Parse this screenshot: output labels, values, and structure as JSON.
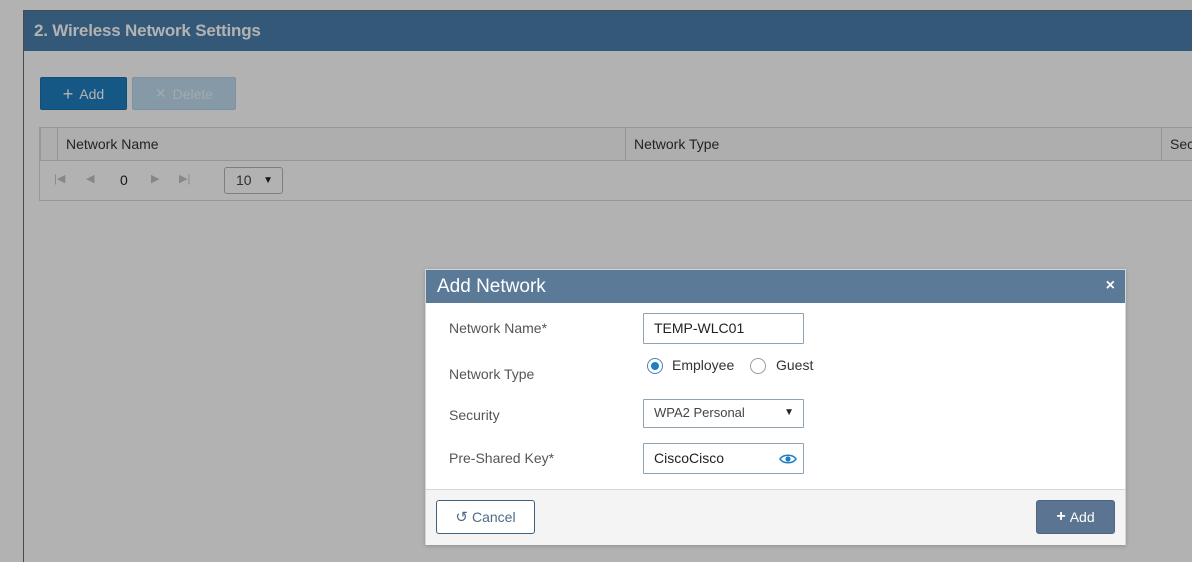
{
  "section": {
    "title": "2. Wireless Network Settings"
  },
  "toolbar": {
    "add_label": "Add",
    "delete_label": "Delete"
  },
  "grid": {
    "columns": [
      "Network Name",
      "Network Type",
      "Sec"
    ],
    "page_number": "0",
    "page_size": "10"
  },
  "modal": {
    "title": "Add Network",
    "close_glyph": "×",
    "fields": {
      "network_name": {
        "label": "Network Name*",
        "value": "TEMP-WLC01"
      },
      "network_type": {
        "label": "Network Type",
        "options": [
          "Employee",
          "Guest"
        ],
        "selected": "Employee"
      },
      "security": {
        "label": "Security",
        "value": "WPA2 Personal"
      },
      "psk": {
        "label": "Pre-Shared Key*",
        "value": "CiscoCisco"
      }
    },
    "cancel_label": "Cancel",
    "add_label": "Add"
  },
  "colors": {
    "section_header": "#4a7fad",
    "primary_button": "#1f7fc1",
    "modal_header": "#5a7a98",
    "modal_add_button": "#5a7491"
  },
  "icons": [
    "plus-icon",
    "close-icon",
    "first-page-icon",
    "prev-page-icon",
    "next-page-icon",
    "last-page-icon",
    "dropdown-caret-icon",
    "eye-icon",
    "undo-icon"
  ]
}
